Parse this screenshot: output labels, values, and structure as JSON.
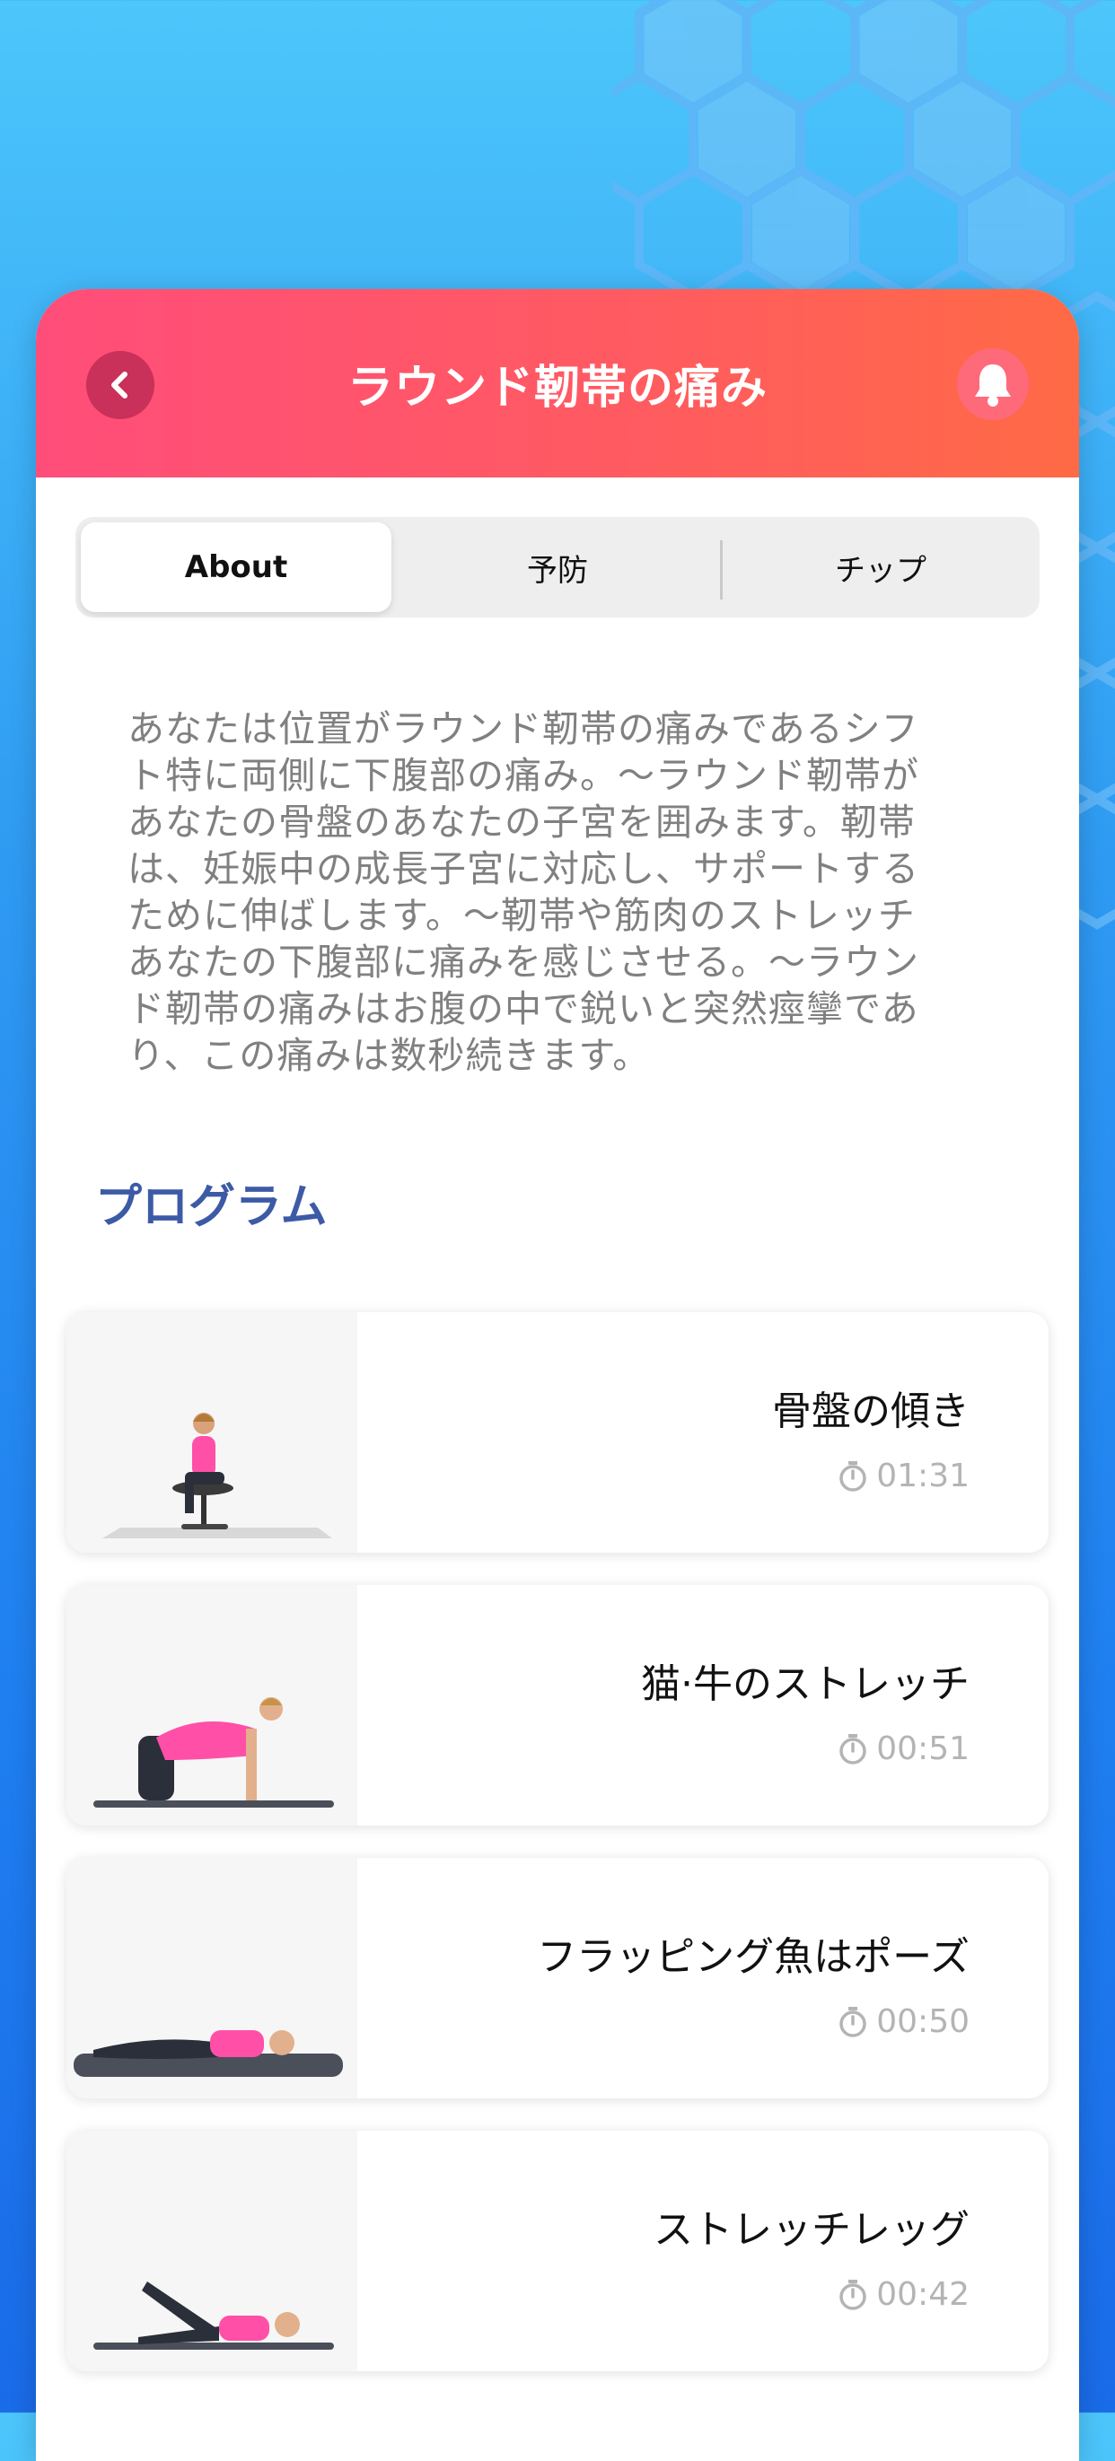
{
  "header": {
    "title": "ラウンド靭帯の痛み",
    "back_icon": "chevron-left-icon",
    "bell_icon": "bell-icon"
  },
  "tabs": [
    {
      "label": "About",
      "active": true
    },
    {
      "label": "予防",
      "active": false
    },
    {
      "label": "チップ",
      "active": false
    }
  ],
  "description": [
    "あなたは位置がラウンド靭帯の痛みであるシフ",
    "ト特に両側に下腹部の痛み。～ラウンド靭帯が",
    "あなたの骨盤のあなたの子宮を囲みます。靭帯",
    "は、妊娠中の成長子宮に対応し、サポートする",
    "ために伸ばします。～靭帯や筋肉のストレッチ",
    "あなたの下腹部に痛みを感じさせる。～ラウン",
    "ド靭帯の痛みはお腹の中で鋭いと突然痙攣であ",
    "り、この痛みは数秒続きます。"
  ],
  "program": {
    "title": "プログラム",
    "items": [
      {
        "name": "骨盤の傾き",
        "time": "01:31",
        "pose": "chair-pose-image"
      },
      {
        "name": "猫·牛のストレッチ",
        "time": "00:51",
        "pose": "cat-cow-pose-image"
      },
      {
        "name": "フラッピング魚はポーズ",
        "time": "00:50",
        "pose": "flapping-fish-pose-image"
      },
      {
        "name": "ストレッチレッグ",
        "time": "00:42",
        "pose": "leg-stretch-pose-image"
      }
    ]
  },
  "colors": {
    "header_start": "#ff4d7a",
    "header_end": "#ff6a45",
    "section_title": "#3c5aa6",
    "time_gray": "#b4b4b4"
  }
}
